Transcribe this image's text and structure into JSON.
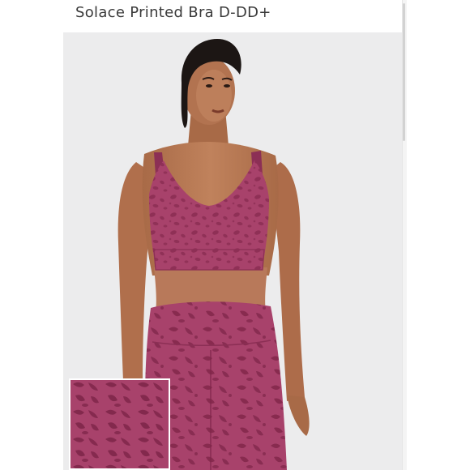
{
  "product": {
    "title": "Solace Printed Bra D-DD+"
  },
  "colors": {
    "fabric": "#a8426b",
    "fabric_dark": "#8c2f55",
    "fabric_print": "#7a2548",
    "skin": "#b97a55",
    "skin_shadow": "#9a5f40",
    "hair": "#1c1614",
    "photo_background": "#ececed"
  }
}
